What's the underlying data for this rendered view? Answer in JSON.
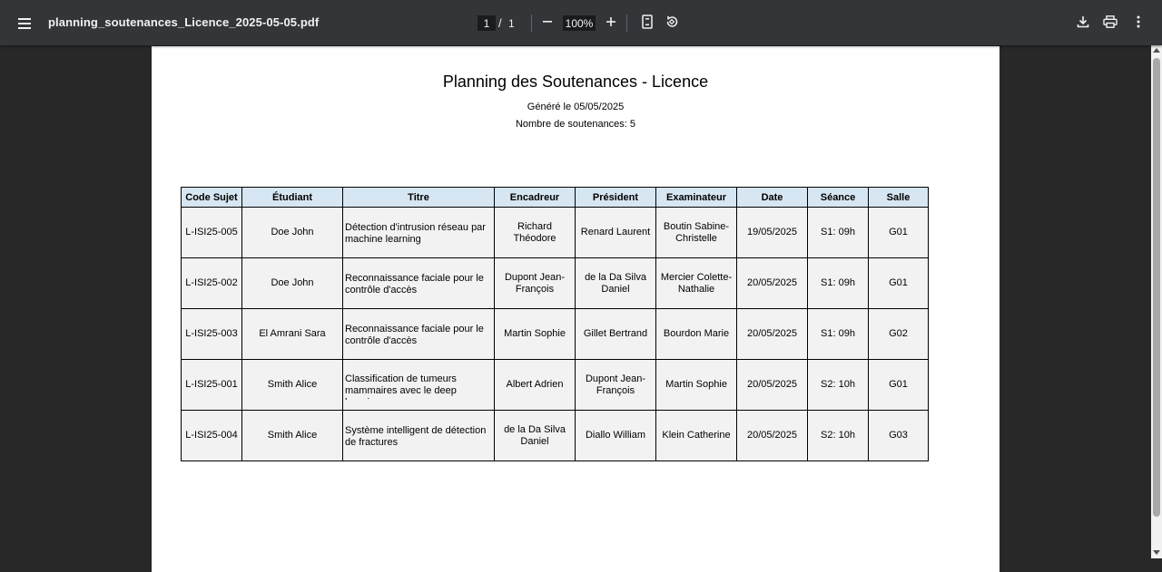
{
  "toolbar": {
    "filename": "planning_soutenances_Licence_2025-05-05.pdf",
    "page_current": "1",
    "page_separator": "/",
    "page_total": "1",
    "zoom": "100%"
  },
  "icons": {
    "menu": "menu-icon",
    "zoom_out": "minus-icon",
    "zoom_in": "plus-icon",
    "fit": "fit-to-page-icon",
    "rotate": "rotate-icon",
    "download": "download-icon",
    "print": "print-icon",
    "more": "more-vert-icon"
  },
  "colors": {
    "toolbar_bg": "#323639",
    "viewer_bg": "#282828",
    "header_bg": "#d6e6f2",
    "row_bg": "#f2f2f2"
  },
  "document": {
    "title": "Planning des Soutenances - Licence",
    "generated": "Généré le 05/05/2025",
    "count": "Nombre de soutenances: 5",
    "columns": [
      "Code Sujet",
      "Étudiant",
      "Titre",
      "Encadreur",
      "Président",
      "Examinateur",
      "Date",
      "Séance",
      "Salle"
    ],
    "rows": [
      [
        "L-ISI25-005",
        "Doe John",
        "Détection d'intrusion réseau par machine learning",
        "Richard Théodore",
        "Renard Laurent",
        "Boutin Sabine-Christelle",
        "19/05/2025",
        "S1: 09h",
        "G01"
      ],
      [
        "L-ISI25-002",
        "Doe John",
        "Reconnaissance faciale pour le contrôle d'accès",
        "Dupont Jean-François",
        "de la Da Silva Daniel",
        "Mercier Colette-Nathalie",
        "20/05/2025",
        "S1: 09h",
        "G01"
      ],
      [
        "L-ISI25-003",
        "El Amrani Sara",
        "Reconnaissance faciale pour le contrôle d'accès",
        "Martin Sophie",
        "Gillet Bertrand",
        "Bourdon Marie",
        "20/05/2025",
        "S1: 09h",
        "G02"
      ],
      [
        "L-ISI25-001",
        "Smith Alice",
        "Classification de tumeurs mammaires avec le deep learning",
        "Albert Adrien",
        "Dupont Jean-François",
        "Martin Sophie",
        "20/05/2025",
        "S2: 10h",
        "G01"
      ],
      [
        "L-ISI25-004",
        "Smith Alice",
        "Système intelligent de détection de fractures",
        "de la Da Silva Daniel",
        "Diallo William",
        "Klein Catherine",
        "20/05/2025",
        "S2: 10h",
        "G03"
      ]
    ]
  }
}
